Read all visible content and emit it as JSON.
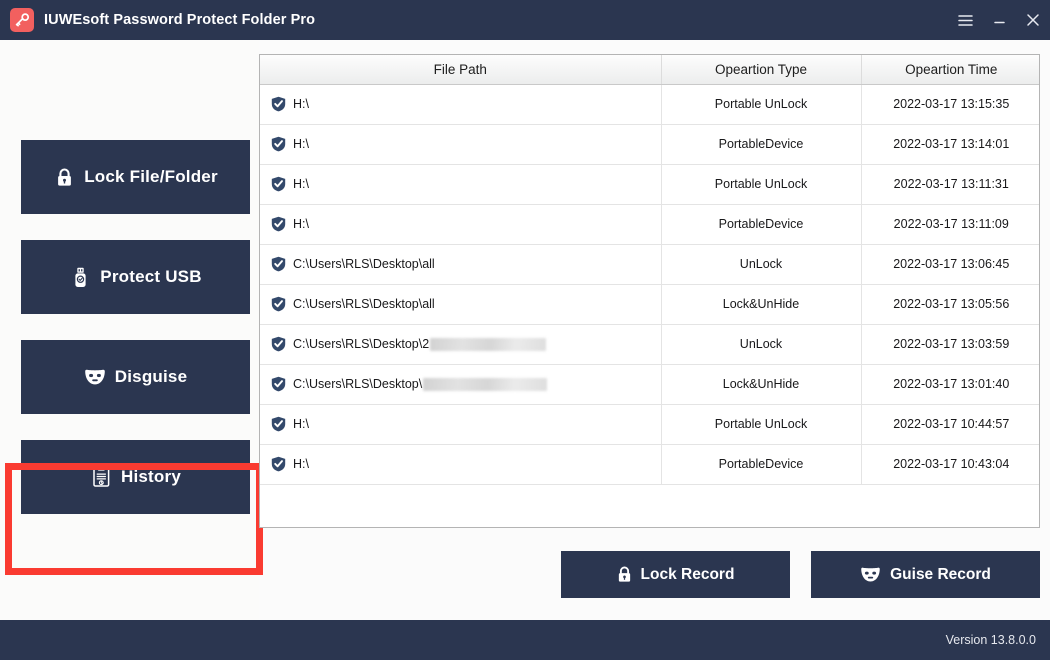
{
  "window": {
    "title": "IUWEsoft Password Protect Folder Pro",
    "app_icon": "key-icon",
    "controls": {
      "menu": "hamburger-menu-icon",
      "minimize": "minimize-icon",
      "close": "close-icon"
    },
    "accent_color": "#f2605f",
    "chrome_color": "#2b3650"
  },
  "sidebar": {
    "items": [
      {
        "label": "Lock File/Folder",
        "icon": "lock-icon",
        "selected": false
      },
      {
        "label": "Protect USB",
        "icon": "usb-drive-icon",
        "selected": false
      },
      {
        "label": "Disguise",
        "icon": "mask-icon",
        "selected": false
      },
      {
        "label": "History",
        "icon": "clipboard-icon",
        "selected": true
      }
    ]
  },
  "annotation": {
    "target": "History",
    "color": "#fa3b31"
  },
  "table": {
    "columns": [
      "File Path",
      "Opeartion Type",
      "Opeartion Time"
    ],
    "rows": [
      {
        "icon": "shield-check-icon",
        "path": "H:\\",
        "redacted": 0,
        "type": "Portable UnLock",
        "time": "2022-03-17 13:15:35"
      },
      {
        "icon": "shield-check-icon",
        "path": "H:\\",
        "redacted": 0,
        "type": "PortableDevice",
        "time": "2022-03-17 13:14:01"
      },
      {
        "icon": "shield-check-icon",
        "path": "H:\\",
        "redacted": 0,
        "type": "Portable UnLock",
        "time": "2022-03-17 13:11:31"
      },
      {
        "icon": "shield-check-icon",
        "path": "H:\\",
        "redacted": 0,
        "type": "PortableDevice",
        "time": "2022-03-17 13:11:09"
      },
      {
        "icon": "shield-check-icon",
        "path": "C:\\Users\\RLS\\Desktop\\all",
        "redacted": 0,
        "type": "UnLock",
        "time": "2022-03-17 13:06:45"
      },
      {
        "icon": "shield-check-icon",
        "path": "C:\\Users\\RLS\\Desktop\\all",
        "redacted": 0,
        "type": "Lock&UnHide",
        "time": "2022-03-17 13:05:56"
      },
      {
        "icon": "shield-check-icon",
        "path": "C:\\Users\\RLS\\Desktop\\2",
        "redacted": 116,
        "type": "UnLock",
        "time": "2022-03-17 13:03:59"
      },
      {
        "icon": "shield-check-icon",
        "path": "C:\\Users\\RLS\\Desktop\\",
        "redacted": 124,
        "type": "Lock&UnHide",
        "time": "2022-03-17 13:01:40"
      },
      {
        "icon": "shield-check-icon",
        "path": "H:\\",
        "redacted": 0,
        "type": "Portable UnLock",
        "time": "2022-03-17 10:44:57"
      },
      {
        "icon": "shield-check-icon",
        "path": "H:\\",
        "redacted": 0,
        "type": "PortableDevice",
        "time": "2022-03-17 10:43:04"
      }
    ]
  },
  "actions": [
    {
      "label": "Lock Record",
      "icon": "lock-icon"
    },
    {
      "label": "Guise Record",
      "icon": "mask-icon"
    }
  ],
  "footer": {
    "version": "Version 13.8.0.0"
  }
}
